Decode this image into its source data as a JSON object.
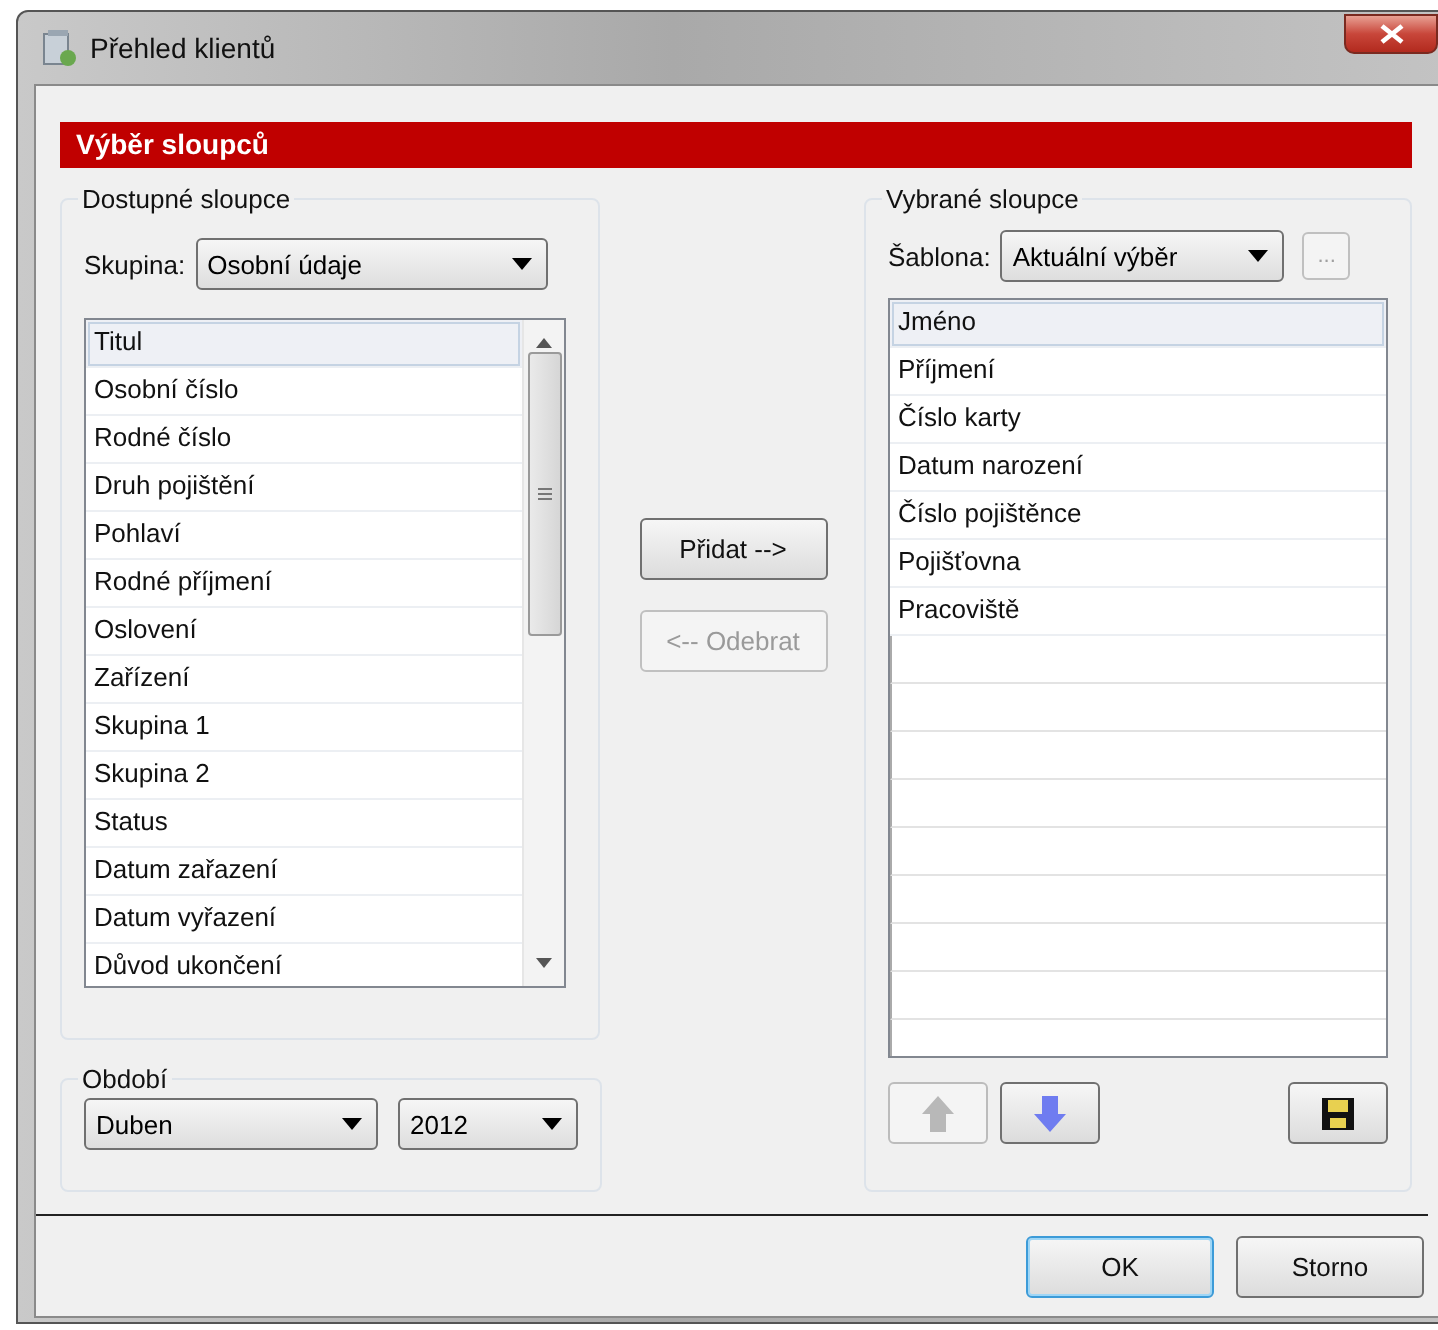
{
  "window": {
    "title": "Přehled klientů"
  },
  "header": "Výběr sloupců",
  "available": {
    "legend": "Dostupné sloupce",
    "group_label": "Skupina:",
    "group_value": "Osobní údaje",
    "items": [
      {
        "label": "Titul",
        "selected": true
      },
      {
        "label": "Osobní číslo",
        "selected": false
      },
      {
        "label": "Rodné číslo",
        "selected": false
      },
      {
        "label": "Druh pojištění",
        "selected": false
      },
      {
        "label": "Pohlaví",
        "selected": false
      },
      {
        "label": "Rodné příjmení",
        "selected": false
      },
      {
        "label": "Oslovení",
        "selected": false
      },
      {
        "label": "Zařízení",
        "selected": false
      },
      {
        "label": "Skupina 1",
        "selected": false
      },
      {
        "label": "Skupina 2",
        "selected": false
      },
      {
        "label": "Status",
        "selected": false
      },
      {
        "label": "Datum zařazení",
        "selected": false
      },
      {
        "label": "Datum vyřazení",
        "selected": false
      },
      {
        "label": "Důvod ukončení",
        "selected": false
      }
    ]
  },
  "transfer_buttons": [
    {
      "label": "Přidat -->",
      "disabled": false
    },
    {
      "label": "<-- Odebrat",
      "disabled": true
    }
  ],
  "period": {
    "legend": "Období",
    "month": "Duben",
    "year": "2012"
  },
  "selected_columns": {
    "legend": "Vybrané sloupce",
    "template_label": "Šablona:",
    "template_value": "Aktuální výběr",
    "browse_button": {
      "label": "...",
      "disabled": true
    },
    "items": [
      {
        "label": "Jméno",
        "selected": true
      },
      {
        "label": "Příjmení",
        "selected": false
      },
      {
        "label": "Číslo karty",
        "selected": false
      },
      {
        "label": "Datum narození",
        "selected": false
      },
      {
        "label": "Číslo pojištěnce",
        "selected": false
      },
      {
        "label": "Pojišťovna",
        "selected": false
      },
      {
        "label": "Pracoviště",
        "selected": false
      }
    ],
    "tools": [
      {
        "kind": "up",
        "disabled": true
      },
      {
        "kind": "down",
        "disabled": false
      },
      {
        "kind": "save",
        "disabled": false
      }
    ]
  },
  "footer_buttons": [
    {
      "label": "OK",
      "default": true
    },
    {
      "label": "Storno",
      "default": false
    }
  ]
}
